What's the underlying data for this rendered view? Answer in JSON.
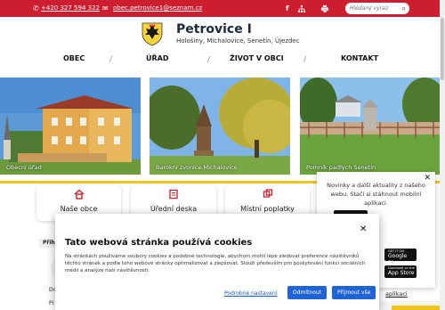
{
  "topbar": {
    "phone": "+420 327 594 322",
    "email": "obec.petrovice1@seznam.cz",
    "search_placeholder": "Hledaný výraz",
    "icons": [
      "phone-icon",
      "email-icon",
      "facebook-icon",
      "sitemap-icon",
      "print-icon",
      "search-icon"
    ]
  },
  "header": {
    "title": "Petrovice I",
    "subtitle": "Hološiny, Michalovice, Senetín, Újezdec"
  },
  "nav": {
    "items": [
      "OBEC",
      "ÚŘAD",
      "ŽIVOT V OBCI",
      "KONTAKT"
    ]
  },
  "photos": [
    {
      "caption": "Obecní úřad"
    },
    {
      "caption": "Barokní zvonice Michalovice"
    },
    {
      "caption": "Pomník padlých Senetín"
    }
  ],
  "cards": [
    {
      "label": "Naše obce",
      "icon": "house-icon"
    },
    {
      "label": "Úřední deska",
      "icon": "board-icon"
    },
    {
      "label": "Místní poplatky",
      "icon": "coins-icon"
    }
  ],
  "fragments": {
    "section_label": "Přihl",
    "text1": "Do",
    "text2": "Pí"
  },
  "app_popup": {
    "text": "Novinky a další aktuality z našeho webu. Stačí si stáhnout mobilní aplikaci.",
    "google_small": "GET IT ON",
    "google_big": "Google Play",
    "apple_small": "Download on the",
    "apple_big": "App Store",
    "link": "aplikaci"
  },
  "cookie": {
    "title": "Tato webová stránka používá cookies",
    "text": "Na stránkách používáme soubory cookies a podobné technologie, abychom mohli lépe sledovat preference návštěvníků těchto stránek a podle toho webové stránky optimalizovat a zlepšovat. Slouží především pro poskytování funkcí sociálních médií a analýze naší návštěvnosti.",
    "settings": "Podrobné nastavení",
    "reject": "Odmítnout",
    "accept": "Přijmout vše"
  },
  "colors": {
    "brand_red": "#cc1e2e",
    "accent_yellow": "#f0c419",
    "button_blue": "#1f63d6"
  }
}
